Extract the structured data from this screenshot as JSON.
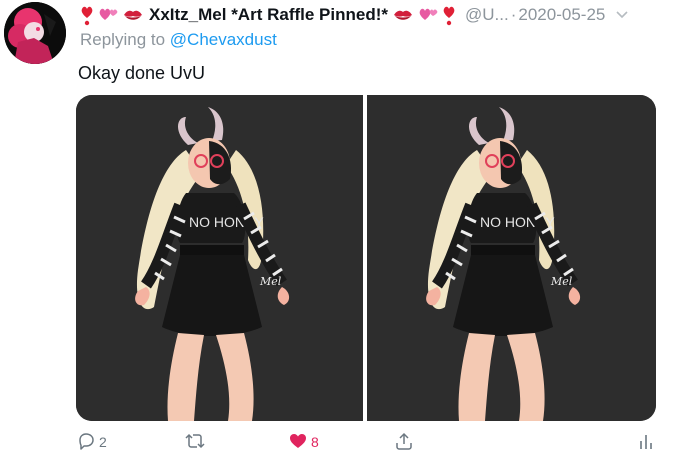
{
  "tweet": {
    "display_name": "XxItz_Mel *Art Raffle Pinned!*",
    "handle": "@U...",
    "separator": "·",
    "date": "2020-05-25",
    "replying_prefix": "Replying to ",
    "replying_to": "@Chevaxdust",
    "text": "Okay done UvU",
    "name_emojis_left": [
      "heart-exclamation",
      "revolving-hearts",
      "kiss-mark"
    ],
    "name_emojis_right": [
      "kiss-mark",
      "revolving-hearts",
      "heart-exclamation"
    ]
  },
  "media": {
    "images": [
      {
        "signature": "Mel",
        "shirt_text": "NO HONEY"
      },
      {
        "signature": "Mel",
        "shirt_text": "NO HONEY"
      }
    ],
    "background_color": "#2d2d2d"
  },
  "actions": {
    "reply_count": "2",
    "retweet_count": "",
    "like_count": "8",
    "liked": true,
    "like_color": "#e0245e"
  },
  "colors": {
    "link": "#1d9bf0",
    "muted": "#8d959c",
    "text": "#0f1419"
  }
}
